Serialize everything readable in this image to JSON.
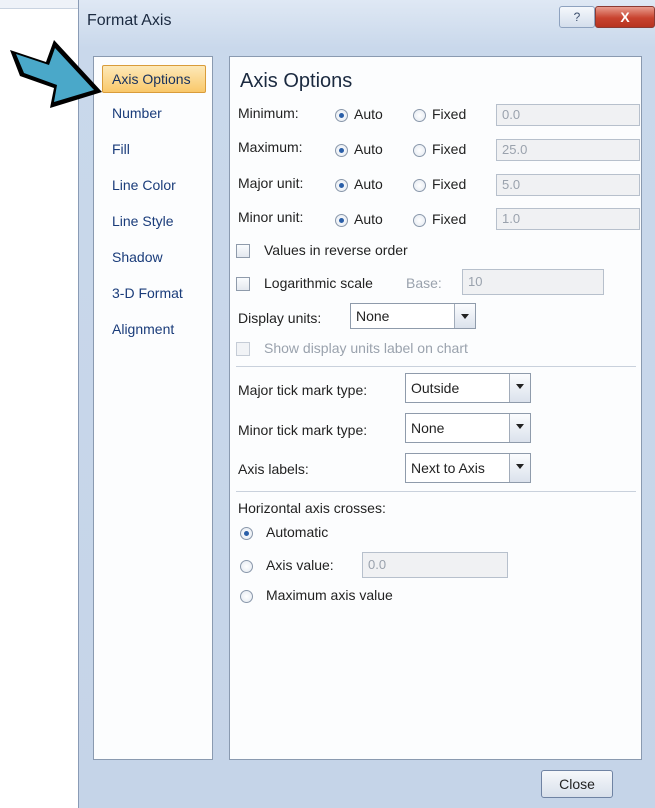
{
  "window": {
    "title": "Format Axis",
    "help_label": "?",
    "close_label": "X"
  },
  "sidebar": {
    "items": [
      {
        "label": "Axis Options",
        "active": true
      },
      {
        "label": "Number"
      },
      {
        "label": "Fill"
      },
      {
        "label": "Line Color"
      },
      {
        "label": "Line Style"
      },
      {
        "label": "Shadow"
      },
      {
        "label": "3-D Format"
      },
      {
        "label": "Alignment"
      }
    ]
  },
  "panel": {
    "title": "Axis Options",
    "rows": [
      {
        "label": "Minimum:",
        "auto": "Auto",
        "fixed": "Fixed",
        "value": "0.0"
      },
      {
        "label": "Maximum:",
        "auto": "Auto",
        "fixed": "Fixed",
        "value": "25.0"
      },
      {
        "label": "Major unit:",
        "auto": "Auto",
        "fixed": "Fixed",
        "value": "5.0"
      },
      {
        "label": "Minor unit:",
        "auto": "Auto",
        "fixed": "Fixed",
        "value": "1.0"
      }
    ],
    "values_reverse": "Values in reverse order",
    "log_scale": "Logarithmic scale",
    "base_label": "Base:",
    "base_value": "10",
    "display_units_label": "Display units:",
    "display_units_value": "None",
    "show_units_label": "Show display units label on chart",
    "major_tick_label": "Major tick mark type:",
    "major_tick_value": "Outside",
    "minor_tick_label": "Minor tick mark type:",
    "minor_tick_value": "None",
    "axis_labels_label": "Axis labels:",
    "axis_labels_value": "Next to Axis",
    "crosses_title": "Horizontal axis crosses:",
    "crosses_automatic": "Automatic",
    "crosses_axis_value": "Axis value:",
    "crosses_axis_value_input": "0.0",
    "crosses_max": "Maximum axis value"
  },
  "footer": {
    "close_label": "Close"
  },
  "colors": {
    "arrow_fill": "#4aa8c9",
    "active_tab": "#f9c86a",
    "link_text": "#1a3c7a"
  },
  "icons": {
    "pointer": "arrow-right-icon"
  }
}
